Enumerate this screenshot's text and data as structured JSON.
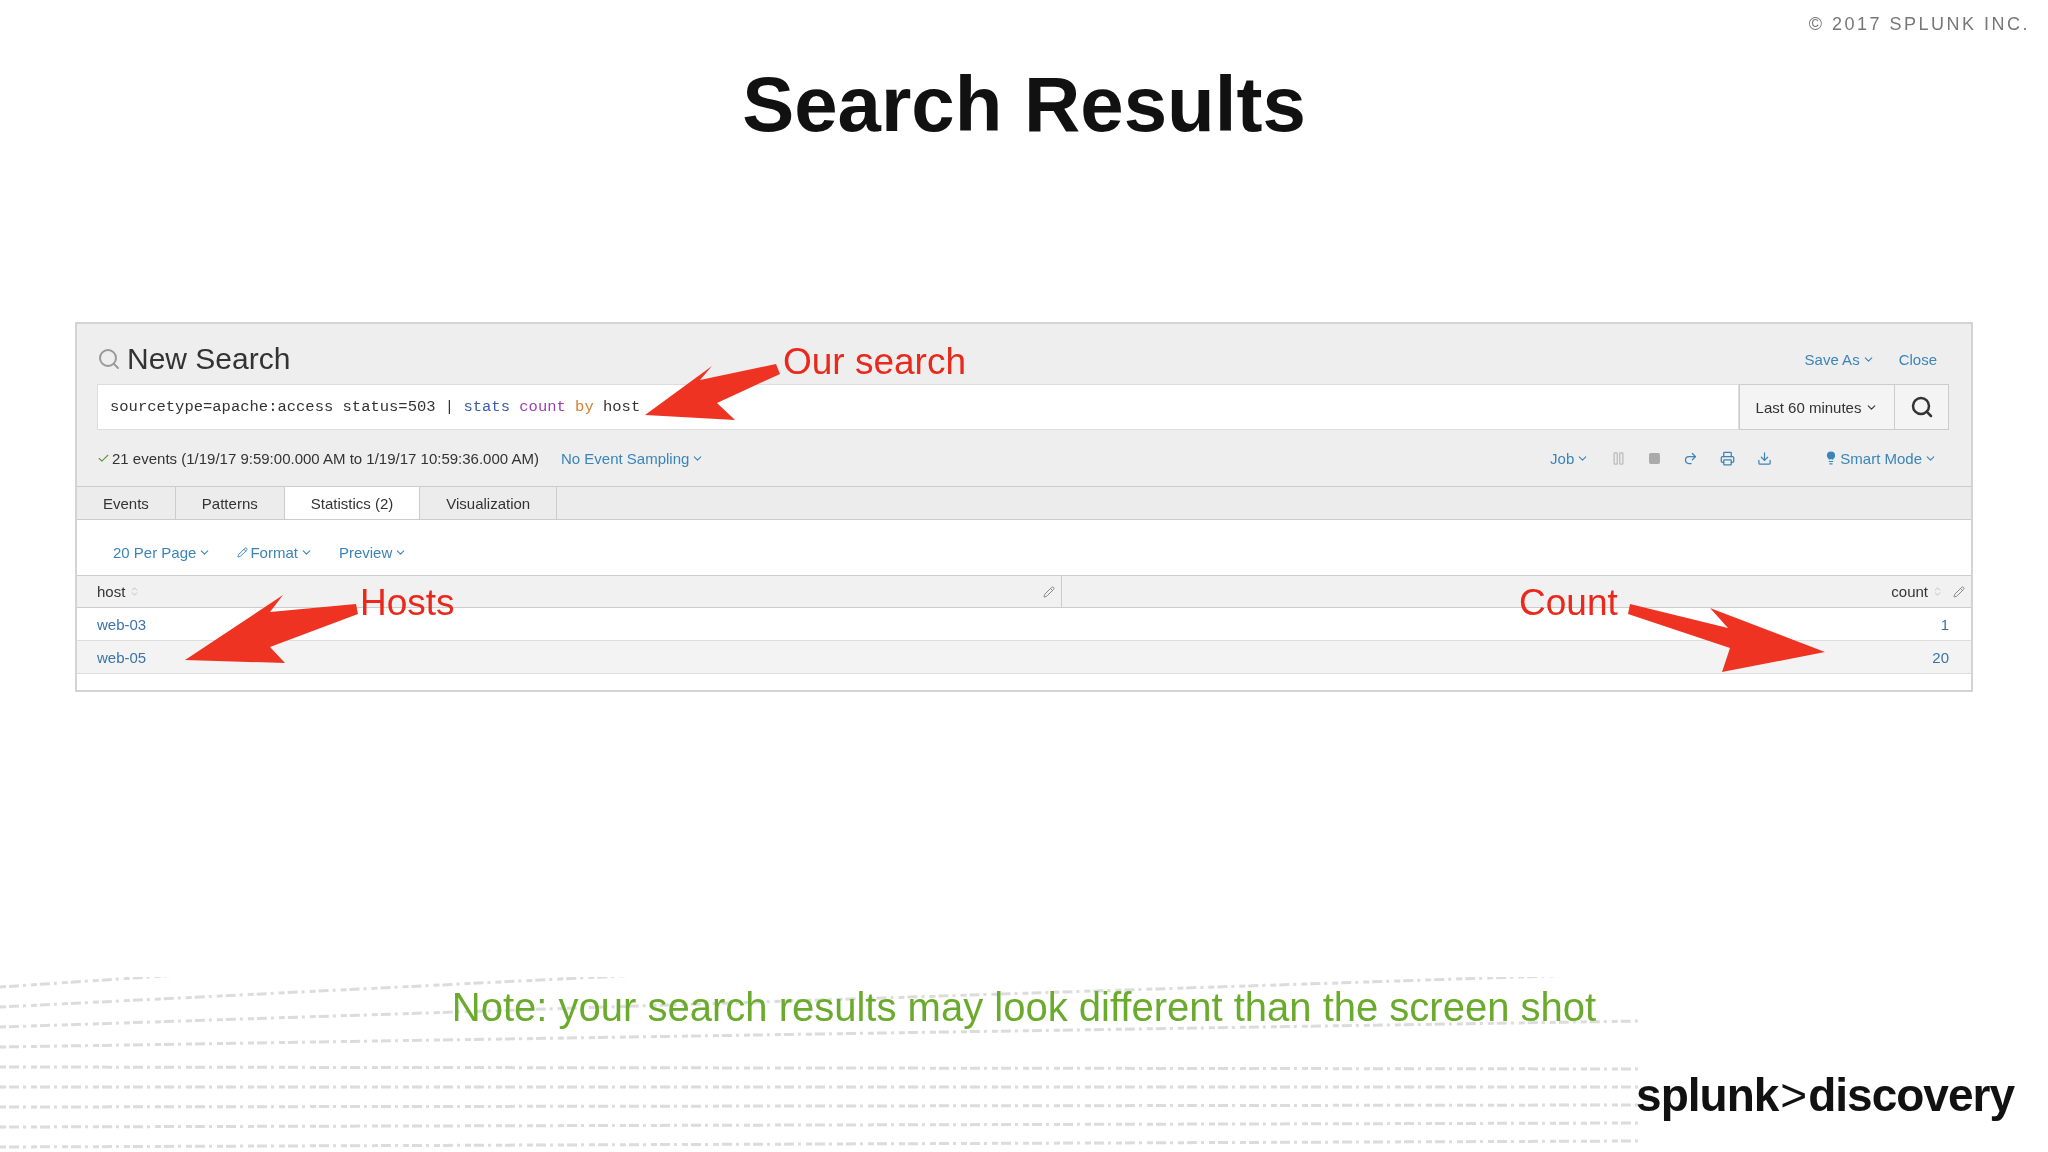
{
  "copyright": "© 2017 SPLUNK INC.",
  "title": "Search Results",
  "search_app": {
    "title": "New Search",
    "header_links": [
      {
        "label": "Save As",
        "dropdown": true
      },
      {
        "label": "Close",
        "dropdown": false
      }
    ],
    "query": [
      {
        "text": "sourcetype=apache:access status=503 | ",
        "kind": "plain"
      },
      {
        "text": "stats ",
        "kind": "command"
      },
      {
        "text": "count ",
        "kind": "function"
      },
      {
        "text": "by ",
        "kind": "keyword"
      },
      {
        "text": "host",
        "kind": "plain"
      }
    ],
    "time_range": "Last 60 minutes",
    "status": "21 events (1/19/17 9:59:00.000 AM to 1/19/17 10:59:36.000 AM)",
    "sampling": "No Event Sampling",
    "job": "Job",
    "mode": "Smart Mode",
    "tabs": [
      {
        "label": "Events",
        "selected": false
      },
      {
        "label": "Patterns",
        "selected": false
      },
      {
        "label": "Statistics (2)",
        "selected": true
      },
      {
        "label": "Visualization",
        "selected": false
      }
    ],
    "options": [
      {
        "label": "20 Per Page",
        "kind": "menu"
      },
      {
        "label": "Format",
        "kind": "edit"
      },
      {
        "label": "Preview",
        "kind": "menu"
      }
    ],
    "table": {
      "columns": [
        "host",
        "count"
      ],
      "rows": [
        [
          "web-03",
          "1"
        ],
        [
          "web-05",
          "20"
        ]
      ]
    }
  },
  "annotations": [
    {
      "text": "Our search"
    },
    {
      "text": "Hosts"
    },
    {
      "text": "Count"
    }
  ],
  "note": "Note: your search results may look different than the screen shot",
  "logo": {
    "left": "splunk",
    "separator": ">",
    "right": "discovery"
  }
}
